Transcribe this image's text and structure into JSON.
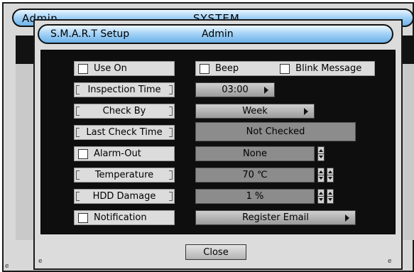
{
  "background_window": {
    "title_left": "Admin",
    "title_center": "SYSTEM",
    "corner_mark": "e"
  },
  "dialog": {
    "title": "S.M.A.R.T Setup",
    "user": "Admin",
    "corner_mark": "e"
  },
  "rows": {
    "use_on": {
      "label": "Use On",
      "checked": false
    },
    "beep": {
      "label": "Beep",
      "checked": false
    },
    "blink_message": {
      "label": "Blink Message",
      "checked": false
    },
    "inspection_time": {
      "label": "Inspection Time",
      "value": "03:00"
    },
    "check_by": {
      "label": "Check By",
      "value": "Week"
    },
    "last_check_time": {
      "label": "Last Check Time",
      "value": "Not Checked"
    },
    "alarm_out": {
      "label": "Alarm-Out",
      "checked": false,
      "value": "None"
    },
    "temperature": {
      "label": "Temperature",
      "value": "70 ℃"
    },
    "hdd_damage": {
      "label": "HDD Damage",
      "value": "1 %"
    },
    "notification": {
      "label": "Notification",
      "checked": false,
      "value": "Register Email"
    }
  },
  "footer": {
    "close_label": "Close"
  },
  "colors": {
    "title_gradient_top": "#eef8ff",
    "title_gradient_bottom": "#6cb1ea",
    "panel": "#0e0e0e",
    "value_field": "#8c8c8c"
  }
}
